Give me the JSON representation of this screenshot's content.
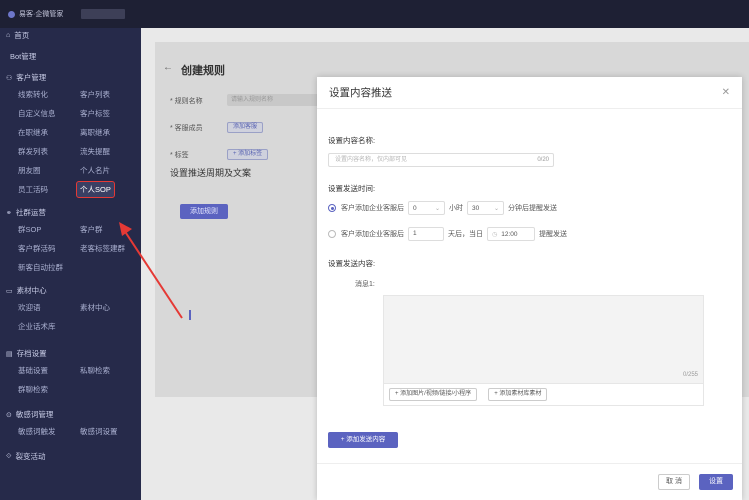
{
  "topbar": {
    "app_name": "易客·企微管家"
  },
  "sidebar": {
    "home": "首页",
    "bot": "Bot管理",
    "groups": [
      {
        "title": "客户管理",
        "icon": "users-icon",
        "rows": [
          [
            "线索转化",
            "客户列表"
          ],
          [
            "自定义信息",
            "客户标签"
          ],
          [
            "在职继承",
            "离职继承"
          ],
          [
            "群发列表",
            "流失提醒"
          ],
          [
            "朋友圈",
            "个人名片"
          ],
          [
            "员工活码",
            "个人SOP"
          ]
        ]
      },
      {
        "title": "社群运营",
        "icon": "group-icon",
        "rows": [
          [
            "群SOP",
            "客户群"
          ],
          [
            "客户群活码",
            "老客标签建群"
          ],
          [
            "新客自动拉群",
            ""
          ]
        ]
      },
      {
        "title": "素材中心",
        "icon": "folder-icon",
        "rows": [
          [
            "欢迎语",
            "素材中心"
          ],
          [
            "企业话术库",
            ""
          ]
        ]
      },
      {
        "title": "存档设置",
        "icon": "archive-icon",
        "rows": [
          [
            "基础设置",
            "私聊检索"
          ],
          [
            "群聊检索",
            ""
          ]
        ]
      },
      {
        "title": "敏感词管理",
        "icon": "warning-icon",
        "rows": [
          [
            "敏感词触发",
            "敏感词设置"
          ]
        ]
      },
      {
        "title": "裂变活动",
        "icon": "share-icon",
        "rows": []
      }
    ]
  },
  "page": {
    "title": "创建规则",
    "rule_name_label": "* 规则名称",
    "rule_name_placeholder": "请输入规则名称",
    "staff_label": "* 客服成员",
    "staff_button": "添加客服",
    "tag_label": "* 标签",
    "tag_button": "+ 添加标签",
    "section_title": "设置推送周期及文案",
    "add_rule_button": "添加规则"
  },
  "modal": {
    "title": "设置内容推送",
    "name_label": "设置内容名称:",
    "name_placeholder": "设置内容名称，仅内部可见",
    "name_count": "0/20",
    "time_label": "设置发送时间:",
    "opt1": {
      "prefix": "客户添加企业客服后",
      "hours": "0",
      "hour_unit": "小时",
      "minutes": "30",
      "suffix": "分钟后提醒发送"
    },
    "opt2": {
      "prefix": "客户添加企业客服后",
      "days": "1",
      "middle": "天后，当日",
      "time": "12:00",
      "suffix": "提醒发送"
    },
    "content_label": "设置发送内容:",
    "message_label": "消息1:",
    "message_count": "0/255",
    "add_media_button": "+ 添加图片/视频/链接/小程序",
    "add_material_button": "+ 添加素材库素材",
    "add_content_button": "+ 添加发送内容",
    "cancel_button": "取 消",
    "ok_button": "设置"
  },
  "colors": {
    "accent": "#5b63c0",
    "sidebar_bg": "#262a4a",
    "annotation": "#e53935"
  }
}
